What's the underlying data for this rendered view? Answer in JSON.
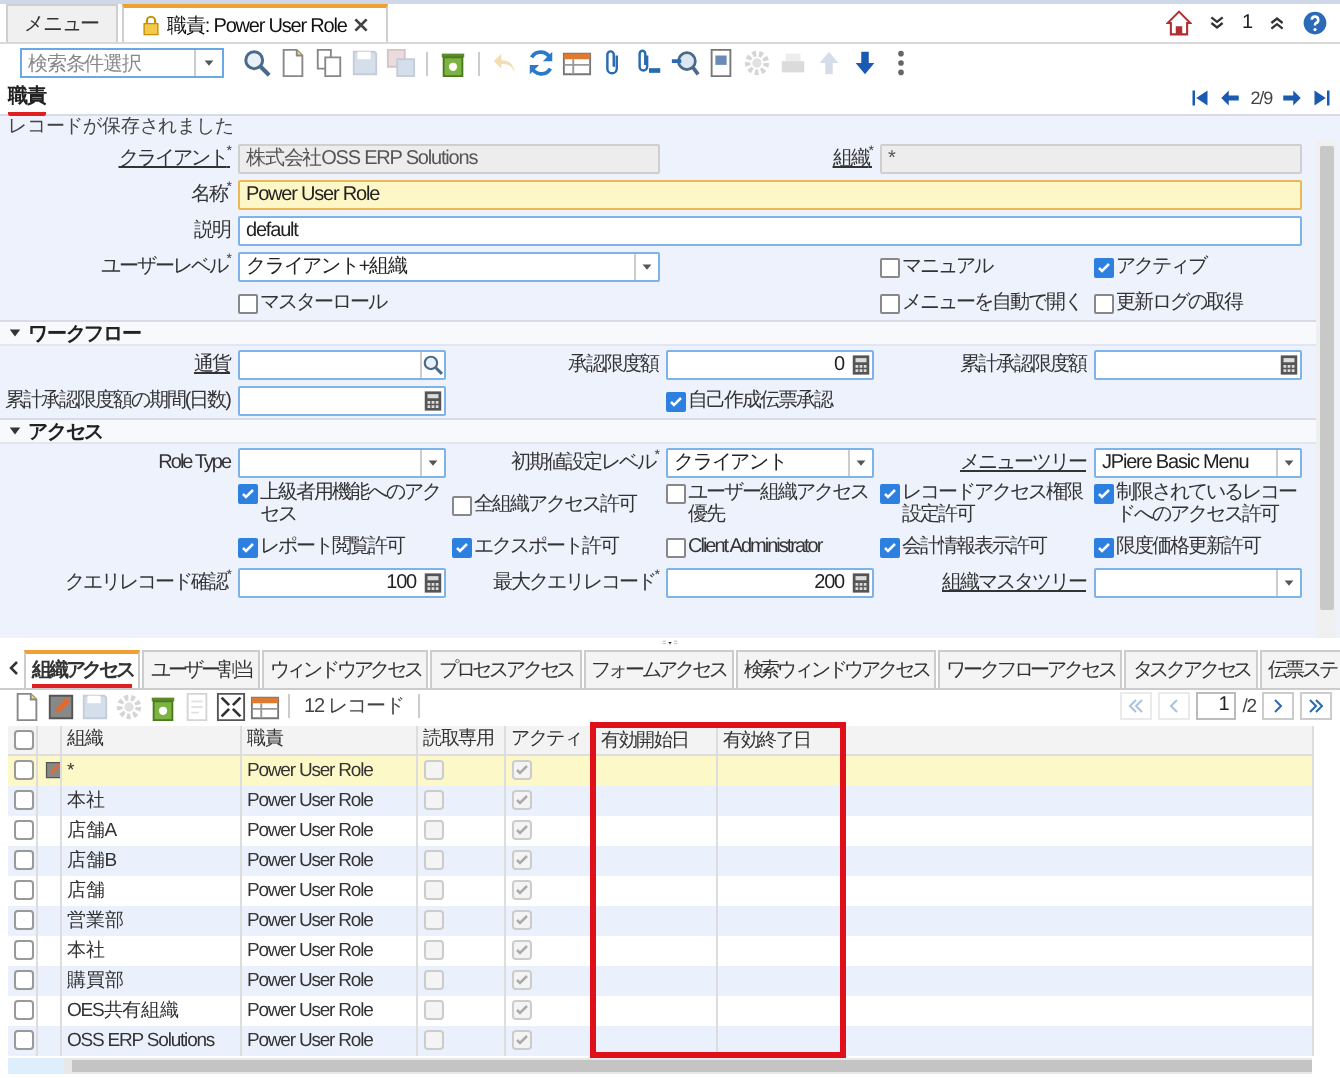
{
  "app_tabs": [
    {
      "label": "メニュー",
      "selected": false,
      "locked": false,
      "closable": false
    },
    {
      "label": "職責: Power User Role",
      "selected": true,
      "locked": true,
      "closable": true
    }
  ],
  "header_actions": {
    "notification_count": "1"
  },
  "toolbar": {
    "search": {
      "placeholder": "検索条件選択"
    },
    "buttons": [
      {
        "kind": "find",
        "disabled": false
      },
      {
        "kind": "new",
        "disabled": false
      },
      {
        "kind": "copy",
        "disabled": false
      },
      {
        "kind": "save",
        "disabled": true
      },
      {
        "kind": "save-new",
        "disabled": true
      },
      {
        "kind": "delete",
        "disabled": false
      },
      {
        "kind": "undo",
        "disabled": true
      },
      {
        "kind": "refresh",
        "disabled": false
      },
      {
        "kind": "grid",
        "disabled": false
      },
      {
        "kind": "attach",
        "disabled": false
      },
      {
        "kind": "chat",
        "disabled": false
      },
      {
        "kind": "zoom",
        "disabled": false
      },
      {
        "kind": "report",
        "disabled": false
      },
      {
        "kind": "process",
        "disabled": true
      },
      {
        "kind": "print",
        "disabled": true
      },
      {
        "kind": "up",
        "disabled": true
      },
      {
        "kind": "down",
        "disabled": false
      },
      {
        "kind": "more",
        "disabled": false
      }
    ]
  },
  "window_title": {
    "text": "職責",
    "marked": true
  },
  "record_nav": {
    "position": "2/9"
  },
  "status_message": "レコードが保存されました",
  "sections": [
    {
      "rows": [
        [
          {
            "kind": "text",
            "label": "クライアント$^{*}$",
            "link": true,
            "readonly": true,
            "focused": false,
            "value": "株式会社OSS ERP Solutions"
          },
          {
            "kind": "text",
            "label": "組織$^{*}$",
            "link": true,
            "readonly": true,
            "focused": false,
            "value": "*"
          }
        ],
        [
          {
            "kind": "text",
            "label": "名称$^{*}$",
            "link": false,
            "readonly": false,
            "focused": true,
            "value": "Power User Role"
          }
        ],
        [
          {
            "kind": "text",
            "label": "説明",
            "link": false,
            "readonly": false,
            "focused": false,
            "value": "default"
          }
        ],
        [
          {
            "kind": "select",
            "label": "ユーザーレベル$^{*}$",
            "link": false,
            "readonly": false,
            "focused": false,
            "value": "クライアント+組織"
          },
          {
            "kind": "checkbox",
            "label": "マニュアル",
            "checked": false
          },
          {
            "kind": "checkbox",
            "label": "アクティブ",
            "checked": true
          }
        ],
        [
          {
            "kind": "checkbox",
            "label": "マスターロール",
            "checked": false
          },
          {
            "kind": "checkbox",
            "label": "メニューを自動で開く",
            "checked": false
          },
          {
            "kind": "checkbox",
            "label": "更新ログの取得",
            "checked": false
          }
        ]
      ]
    },
    {
      "title": "ワークフロー",
      "expanded": true,
      "rows": [
        [
          {
            "kind": "search",
            "label": "通貨",
            "link": true,
            "readonly": false,
            "focused": false
          },
          {
            "kind": "number",
            "label": "承認限度額",
            "link": false,
            "readonly": false,
            "focused": false,
            "value": "0"
          },
          {
            "kind": "number",
            "label": "累計承認限度額",
            "link": false,
            "readonly": false,
            "focused": false
          }
        ],
        [
          {
            "kind": "number",
            "label": "累計承認限度額の期間(日数)",
            "link": false,
            "readonly": false,
            "focused": false
          },
          {
            "kind": "checkbox",
            "label": "自己作成伝票承認",
            "checked": true
          }
        ]
      ]
    },
    {
      "title": "アクセス",
      "expanded": true,
      "rows": [
        [
          {
            "kind": "select",
            "label": "Role Type",
            "link": false,
            "readonly": false,
            "focused": false
          },
          {
            "kind": "select",
            "label": "初期値設定レベル$^{*}$",
            "link": false,
            "readonly": false,
            "focused": false,
            "value": "クライアント"
          },
          {
            "kind": "select",
            "label": "メニューツリー",
            "link": true,
            "readonly": false,
            "focused": false,
            "value": "JPiere Basic Menu"
          }
        ],
        [
          {
            "kind": "checkbox",
            "label": "上級者用機能へのアクセス",
            "checked": true
          },
          {
            "kind": "checkbox",
            "label": "全組織アクセス許可",
            "checked": false
          },
          {
            "kind": "checkbox",
            "label": "ユーザー組織アクセス優先",
            "checked": false
          },
          {
            "kind": "checkbox",
            "label": "レコードアクセス権限設定許可",
            "checked": true
          },
          {
            "kind": "checkbox",
            "label": "制限されているレコードへのアクセス許可",
            "checked": true
          }
        ],
        [
          {
            "kind": "checkbox",
            "label": "レポート閲覧許可",
            "checked": true
          },
          {
            "kind": "checkbox",
            "label": "エクスポート許可",
            "checked": true
          },
          {
            "kind": "checkbox",
            "label": "Client Administrator",
            "checked": false
          },
          {
            "kind": "checkbox",
            "label": "会計情報表示許可",
            "checked": true
          },
          {
            "kind": "checkbox",
            "label": "限度価格更新許可",
            "checked": true
          }
        ],
        [
          {
            "kind": "number",
            "label": "クエリレコード確認$^{*}$",
            "link": false,
            "readonly": false,
            "focused": false,
            "value": "100"
          },
          {
            "kind": "number",
            "label": "最大クエリレコード$^{*}$",
            "link": false,
            "readonly": false,
            "focused": false,
            "value": "200"
          },
          {
            "kind": "select",
            "label": "組織マスタツリー",
            "link": true,
            "readonly": false,
            "focused": false
          }
        ]
      ]
    }
  ],
  "detail_tabs": [
    {
      "label": "組織アクセス",
      "selected": true,
      "marked": true
    },
    {
      "label": "ユーザー割当",
      "selected": false,
      "marked": false
    },
    {
      "label": "ウィンドウアクセス",
      "selected": false,
      "marked": false
    },
    {
      "label": "プロセスアクセス",
      "selected": false,
      "marked": false
    },
    {
      "label": "フォームアクセス",
      "selected": false,
      "marked": false
    },
    {
      "label": "検索ウィンドウアクセス",
      "selected": false,
      "marked": false
    },
    {
      "label": "ワークフローアクセス",
      "selected": false,
      "marked": false
    },
    {
      "label": "タスクアクセス",
      "selected": false,
      "marked": false
    },
    {
      "label": "伝票ステ",
      "selected": false,
      "marked": false
    }
  ],
  "detail_toolbar": {
    "buttons": [
      {
        "kind": "new",
        "disabled": false
      },
      {
        "kind": "edit",
        "disabled": false
      },
      {
        "kind": "save",
        "disabled": true
      },
      {
        "kind": "process",
        "disabled": true
      },
      {
        "kind": "delete",
        "disabled": false
      },
      {
        "kind": "doc",
        "disabled": true
      },
      {
        "kind": "expand",
        "disabled": false
      },
      {
        "kind": "grid",
        "disabled": false
      }
    ],
    "record_count": "12 レコード"
  },
  "pager": {
    "page": "1",
    "total": "/2",
    "first_disabled": true,
    "prev_disabled": true,
    "next_disabled": false,
    "last_disabled": false
  },
  "grid": {
    "select_all": false,
    "columns": [
      {
        "label": "組織",
        "highlighted": false
      },
      {
        "label": "職責",
        "highlighted": false
      },
      {
        "label": "読取専用",
        "highlighted": false
      },
      {
        "label": "アクティ",
        "highlighted": false
      },
      {
        "label": "有効開始日",
        "highlighted": true
      },
      {
        "label": "有効終了日",
        "highlighted": true
      }
    ],
    "rows": [
      {
        "selected": true,
        "checked": false,
        "org": "*",
        "role": "Power User Role",
        "read_only": false,
        "active": true
      },
      {
        "selected": false,
        "checked": false,
        "org": "本社",
        "role": "Power User Role",
        "read_only": false,
        "active": true
      },
      {
        "selected": false,
        "checked": false,
        "org": "店舗A",
        "role": "Power User Role",
        "read_only": false,
        "active": true
      },
      {
        "selected": false,
        "checked": false,
        "org": "店舗B",
        "role": "Power User Role",
        "read_only": false,
        "active": true
      },
      {
        "selected": false,
        "checked": false,
        "org": "店舗",
        "role": "Power User Role",
        "read_only": false,
        "active": true
      },
      {
        "selected": false,
        "checked": false,
        "org": "営業部",
        "role": "Power User Role",
        "read_only": false,
        "active": true
      },
      {
        "selected": false,
        "checked": false,
        "org": "本社",
        "role": "Power User Role",
        "read_only": false,
        "active": true
      },
      {
        "selected": false,
        "checked": false,
        "org": "購買部",
        "role": "Power User Role",
        "read_only": false,
        "active": true
      },
      {
        "selected": false,
        "checked": false,
        "org": "OES共有組織",
        "role": "Power User Role",
        "read_only": false,
        "active": true
      },
      {
        "selected": false,
        "checked": false,
        "org": "OSS ERP Solutions",
        "role": "Power User Role",
        "read_only": false,
        "active": true
      }
    ]
  }
}
